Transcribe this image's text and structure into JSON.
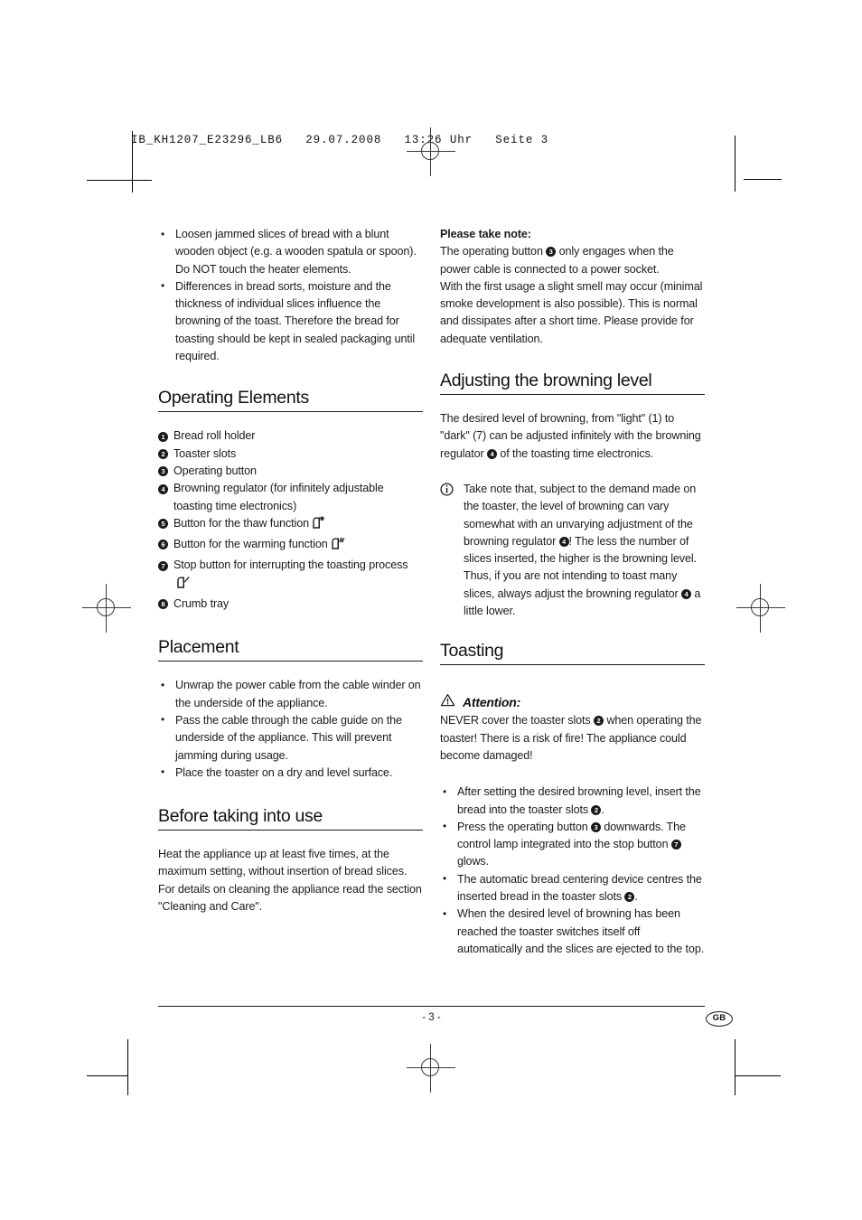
{
  "print_header": "IB_KH1207_E23296_LB6   29.07.2008   13:26 Uhr   Seite 3",
  "left_column": {
    "top_bullets": [
      "Loosen jammed slices of bread with a blunt wooden object (e.g. a wooden spatula or spoon). Do NOT touch the heater elements.",
      "Differences in bread sorts, moisture and the thickness of individual slices influence the browning of the toast. Therefore the bread for toasting should be kept in sealed packaging until required."
    ],
    "operating_elements": {
      "heading": "Operating Elements",
      "items": [
        {
          "num": "1",
          "label": "Bread roll holder",
          "icon": ""
        },
        {
          "num": "2",
          "label": "Toaster slots",
          "icon": ""
        },
        {
          "num": "3",
          "label": "Operating button",
          "icon": ""
        },
        {
          "num": "4",
          "label": "Browning regulator (for infinitely adjustable toasting time electronics)",
          "icon": ""
        },
        {
          "num": "5",
          "label": "Button for the thaw function",
          "icon": "toast-thaw-icon"
        },
        {
          "num": "6",
          "label": "Button for the warming function",
          "icon": "toast-warm-icon"
        },
        {
          "num": "7",
          "label": "Stop button for interrupting the toasting process",
          "icon": "toast-stop-icon"
        },
        {
          "num": "8",
          "label": "Crumb tray",
          "icon": ""
        }
      ]
    },
    "placement": {
      "heading": "Placement",
      "bullets": [
        "Unwrap the power cable from the cable winder on the underside of the appliance.",
        "Pass the cable through the cable guide on the underside of the appliance. This will prevent jamming during usage.",
        "Place the toaster on a dry and level surface."
      ]
    },
    "before_use": {
      "heading": "Before taking into use",
      "paragraph": "Heat the appliance up at least five times, at the maximum setting, without insertion of bread slices. For details on cleaning the appliance read the section \"Cleaning and Care\"."
    }
  },
  "right_column": {
    "note": {
      "title": "Please take note:",
      "line1_a": "The operating button",
      "line1_num": "3",
      "line1_b": "only engages when the power cable is connected to a power socket.",
      "line2": "With the first usage a slight smell may occur (minimal smoke development is also possible). This is normal and dissipates after a short time. Please provide for adequate ventilation."
    },
    "browning": {
      "heading": "Adjusting the browning level",
      "para_a": "The desired level of browning, from \"light\" (1) to \"dark\" (7) can be adjusted infinitely with the browning regulator",
      "para_num": "4",
      "para_b": "of the toasting time electronics.",
      "info": {
        "icon": "info-circle-icon",
        "part_a": "Take note that, subject to the demand made on the toaster, the level of browning can vary somewhat with an unvarying adjustment of the browning regulator",
        "num_1": "4",
        "part_b": "! The less the number of slices inserted, the higher is the browning level. Thus, if you are not intending to toast many slices, always adjust the browning regulator",
        "num_2": "4",
        "part_c": "a little lower."
      }
    },
    "toasting": {
      "heading": "Toasting",
      "attention": {
        "icon": "warning-triangle-icon",
        "word": "Attention:",
        "text_a": "NEVER cover the toaster slots",
        "num": "2",
        "text_b": "when operating the toaster! There is a risk of fire! The appliance could become damaged!"
      },
      "bullets": [
        {
          "a": "After setting the desired browning level, insert the bread into the toaster slots",
          "num": "2",
          "b": "."
        },
        {
          "a": "Press the operating button",
          "num": "3",
          "b": "downwards. The control lamp integrated into the stop button",
          "num2": "7",
          "c": "glows."
        },
        {
          "a": "The automatic bread centering device centres the inserted bread in the toaster slots",
          "num": "2",
          "b": "."
        },
        {
          "a": "When the desired level of browning has been reached the toaster switches itself off automatically and the slices are ejected to the top.",
          "num": "",
          "b": ""
        }
      ]
    }
  },
  "footer": {
    "page_number": "- 3 -",
    "language_badge": "GB"
  }
}
